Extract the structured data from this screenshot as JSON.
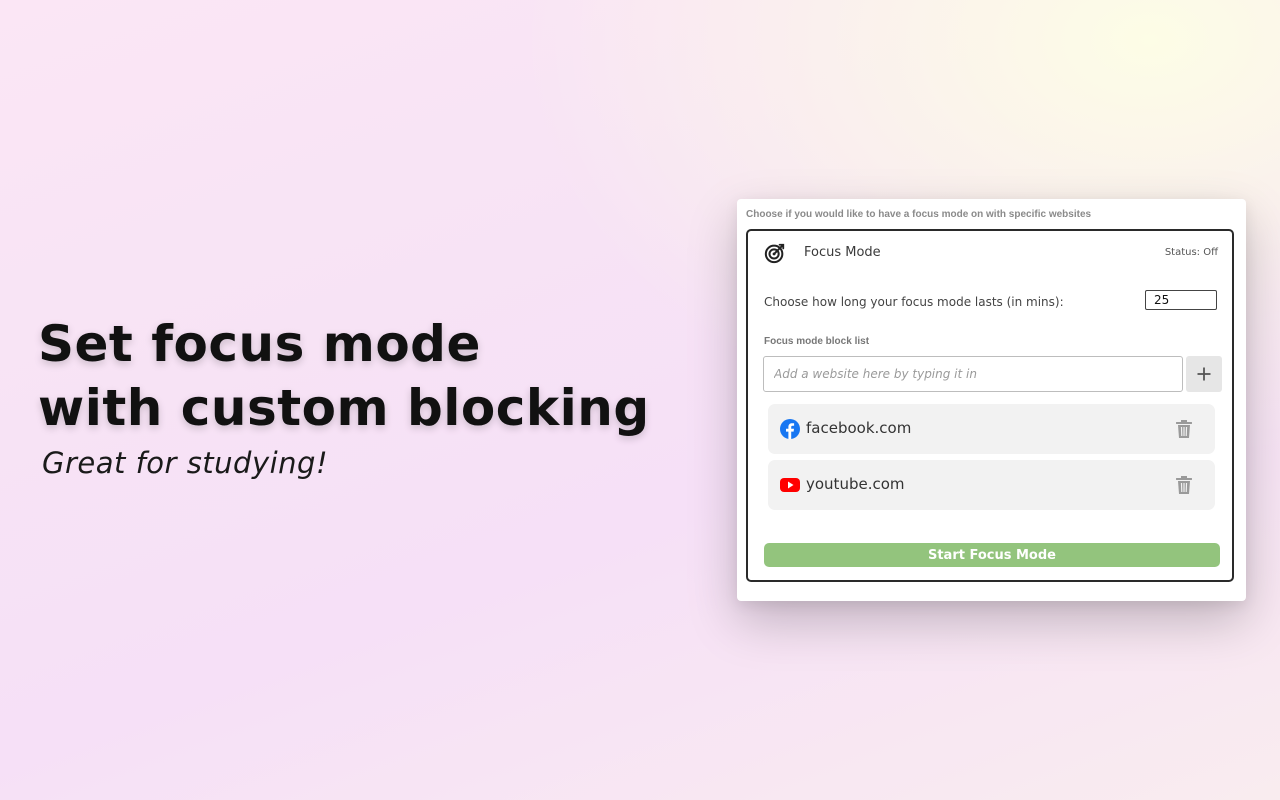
{
  "hero": {
    "title_line1": "Set focus mode",
    "title_line2": "with custom blocking",
    "subtitle": "Great for studying!"
  },
  "panel": {
    "caption": "Choose if you would like to have a focus mode on with specific websites",
    "focus_mode": {
      "icon": "target-icon",
      "title": "Focus Mode",
      "status": "Status: Off"
    },
    "duration": {
      "label": "Choose how long your focus mode lasts (in mins):",
      "value": "25"
    },
    "block_list": {
      "label": "Focus mode block list",
      "placeholder": "Add a website here by typing it in",
      "add_icon": "plus-icon",
      "sites": [
        {
          "name": "facebook.com",
          "icon": "facebook-icon",
          "color": "#1877f2"
        },
        {
          "name": "youtube.com",
          "icon": "youtube-icon",
          "color": "#ff0000"
        }
      ],
      "delete_icon": "trash-icon"
    },
    "start_button": {
      "label": "Start Focus Mode",
      "color": "#93c47d"
    }
  }
}
